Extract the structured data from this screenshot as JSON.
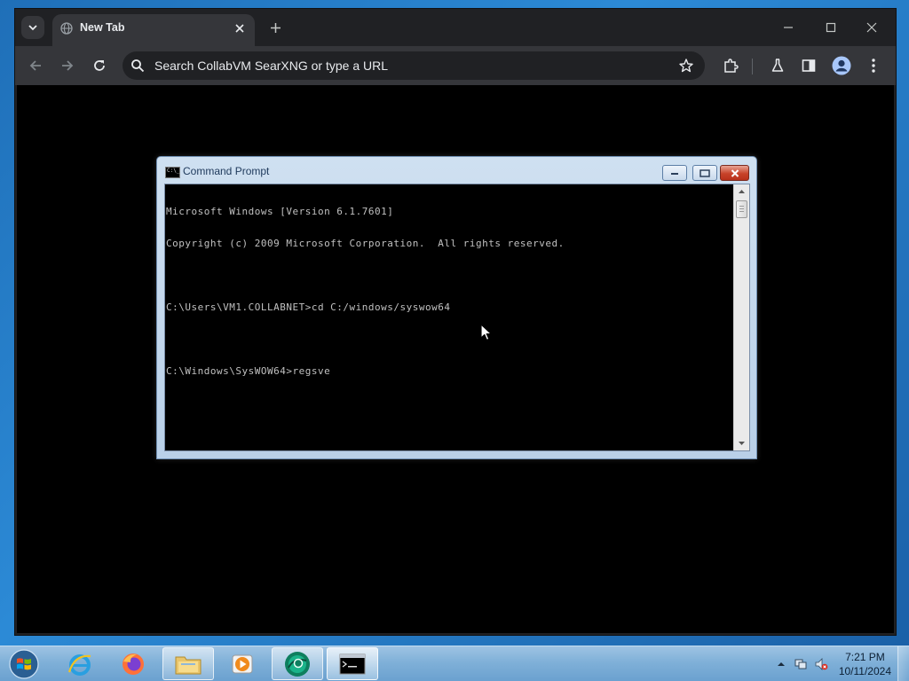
{
  "browser": {
    "tab_title": "New Tab",
    "omnibox_placeholder": "Search CollabVM SearXNG or type a URL"
  },
  "cmd": {
    "title": "Command Prompt",
    "icon_text": "C:\\_",
    "lines": [
      "Microsoft Windows [Version 6.1.7601]",
      "Copyright (c) 2009 Microsoft Corporation.  All rights reserved.",
      "",
      "C:\\Users\\VM1.COLLABNET>cd C:/windows/syswow64",
      "",
      "C:\\Windows\\SysWOW64>regsve"
    ]
  },
  "taskbar": {
    "apps": [
      {
        "name": "internet-explorer",
        "icon": "ie-icon"
      },
      {
        "name": "firefox",
        "icon": "firefox-icon"
      },
      {
        "name": "windows-explorer",
        "icon": "folder-icon"
      },
      {
        "name": "media-player",
        "icon": "media-player-icon"
      },
      {
        "name": "chrome",
        "icon": "chrome-icon"
      },
      {
        "name": "command-prompt",
        "icon": "cmd-icon"
      }
    ],
    "clock_time": "7:21 PM",
    "clock_date": "10/11/2024"
  },
  "colors": {
    "browser_frame": "#202124",
    "toolbar": "#35363a",
    "console_bg": "#000000",
    "console_fg": "#c0c0c0",
    "taskbar": "#7fb0d8"
  }
}
